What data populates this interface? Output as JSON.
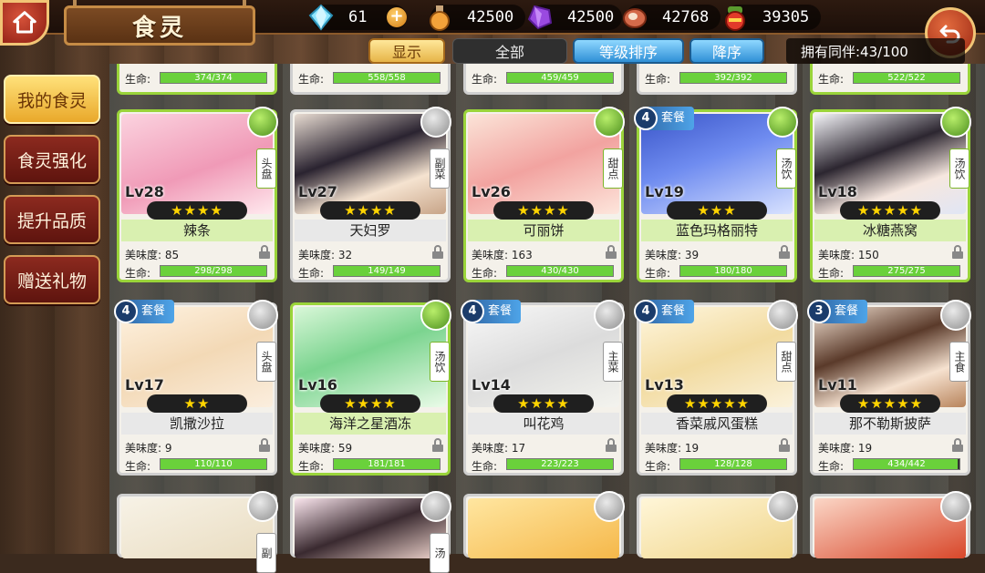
{
  "header": {
    "title": "食灵",
    "resources": [
      {
        "icon": "crystal-icon",
        "value": "61"
      },
      {
        "icon": "potion-icon",
        "value": "42500"
      },
      {
        "icon": "gem-icon",
        "value": "42500"
      },
      {
        "icon": "meat-icon",
        "value": "42768"
      },
      {
        "icon": "bag-icon",
        "value": "39305"
      }
    ]
  },
  "filters": {
    "show": "显示",
    "all": "全部",
    "sort_level": "等级排序",
    "order": "降序"
  },
  "owned": "拥有同伴:43/100",
  "side_menu": [
    {
      "label": "我的食灵",
      "active": true
    },
    {
      "label": "食灵强化",
      "active": false
    },
    {
      "label": "提升品质",
      "active": false
    },
    {
      "label": "赠送礼物",
      "active": false
    }
  ],
  "labels": {
    "taste": "美味度:",
    "hp": "生命:",
    "set": "套餐"
  },
  "top_row": [
    {
      "hp": "374/374"
    },
    {
      "hp": "558/558"
    },
    {
      "hp": "459/459"
    },
    {
      "hp": "392/392"
    },
    {
      "hp": "522/522"
    }
  ],
  "cards_row1": [
    {
      "name": "辣条",
      "level": "Lv28",
      "stars": "★★★★",
      "taste": "85",
      "hp": "298/298",
      "category": "头盘"
    },
    {
      "name": "天妇罗",
      "level": "Lv27",
      "stars": "★★★★",
      "taste": "32",
      "hp": "149/149",
      "category": "副菜"
    },
    {
      "name": "可丽饼",
      "level": "Lv26",
      "stars": "★★★★",
      "taste": "163",
      "hp": "430/430",
      "category": "甜点"
    },
    {
      "name": "蓝色玛格丽特",
      "level": "Lv19",
      "stars": "★★★",
      "taste": "39",
      "hp": "180/180",
      "category": "汤饮",
      "set": "4"
    },
    {
      "name": "冰糖燕窝",
      "level": "Lv18",
      "stars": "★★★★★",
      "taste": "150",
      "hp": "275/275",
      "category": "汤饮"
    }
  ],
  "cards_row2": [
    {
      "name": "凯撒沙拉",
      "level": "Lv17",
      "stars": "★★",
      "taste": "9",
      "hp": "110/110",
      "category": "头盘",
      "set": "4"
    },
    {
      "name": "海洋之星酒冻",
      "level": "Lv16",
      "stars": "★★★★",
      "taste": "59",
      "hp": "181/181",
      "category": "汤饮"
    },
    {
      "name": "叫花鸡",
      "level": "Lv14",
      "stars": "★★★★",
      "taste": "17",
      "hp": "223/223",
      "category": "主菜",
      "set": "4"
    },
    {
      "name": "香菜戚风蛋糕",
      "level": "Lv13",
      "stars": "★★★★★",
      "taste": "19",
      "hp": "128/128",
      "category": "甜点",
      "set": "4"
    },
    {
      "name": "那不勒斯披萨",
      "level": "Lv11",
      "stars": "★★★★★",
      "taste": "19",
      "hp": "434/442",
      "category": "主食",
      "set": "3"
    }
  ],
  "cards_row3": [
    {
      "category": "副"
    },
    {
      "category": "汤"
    },
    {
      "category": ""
    },
    {
      "category": ""
    },
    {
      "category": ""
    }
  ]
}
